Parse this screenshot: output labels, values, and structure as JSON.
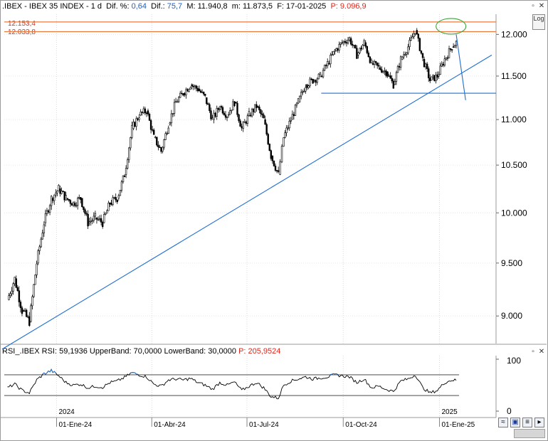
{
  "header": {
    "symbol": ".IBEX - IBEX 35 INDEX - 1 d",
    "dif_pct_label": "Dif. %:",
    "dif_pct_value": "0,64",
    "dif_label": "Dif.:",
    "dif_value": "75,7",
    "max_label": "M:",
    "max_value": "11.940,8",
    "min_label": "m:",
    "min_value": "11.873,5",
    "date_label": "F:",
    "date_value": "17-01-2025",
    "price_label": "P:",
    "price_value": "9.096,9"
  },
  "rsi_header": {
    "text": "RSI_.IBEX  RSI: 59,1936  UpperBand: 70,0000  LowerBand: 30,0000",
    "price_text": "P: 205,9524"
  },
  "buttons": {
    "log_label": "Log",
    "window_glyph_top": "▫",
    "close_glyph": "✕"
  },
  "level_labels": [
    "12.153,4",
    "12.033,8"
  ],
  "colors": {
    "candle": "#000000",
    "trendline": "#1f6fd1",
    "level_line": "#e87b3e",
    "highlight_ellipse": "#3aa53a",
    "rsi_line": "#000000",
    "rsi_overbought": "#1f6fd1",
    "price_red": "#e0261b"
  },
  "chart_data": [
    {
      "type": "line",
      "title": ".IBEX - IBEX 35 INDEX - 1 d",
      "y_axis": {
        "ticks": [
          "9.000",
          "9.500",
          "10.000",
          "10.500",
          "11.000",
          "11.500",
          "12.000"
        ],
        "ylim": [
          8750,
          12250
        ],
        "scale": "log"
      },
      "x_axis": {
        "ticks": [
          "01-Ene-24",
          "01-Abr-24",
          "01-Jul-24",
          "01-Oct-24",
          "01-Ene-25"
        ],
        "year_labels": [
          "2024",
          "2025"
        ]
      },
      "series": [
        {
          "style": "candlestick",
          "x": [
            "2023-11-15",
            "2023-11-22",
            "2023-11-29",
            "2023-12-06",
            "2023-12-13",
            "2023-12-20",
            "2023-12-27",
            "2024-01-03",
            "2024-01-10",
            "2024-01-17",
            "2024-01-24",
            "2024-01-31",
            "2024-02-07",
            "2024-02-14",
            "2024-02-21",
            "2024-02-28",
            "2024-03-06",
            "2024-03-13",
            "2024-03-20",
            "2024-03-27",
            "2024-04-03",
            "2024-04-10",
            "2024-04-17",
            "2024-04-24",
            "2024-05-01",
            "2024-05-08",
            "2024-05-15",
            "2024-05-22",
            "2024-05-29",
            "2024-06-05",
            "2024-06-12",
            "2024-06-19",
            "2024-06-26",
            "2024-07-03",
            "2024-07-10",
            "2024-07-17",
            "2024-07-24",
            "2024-07-31",
            "2024-08-05",
            "2024-08-12",
            "2024-08-19",
            "2024-08-26",
            "2024-09-02",
            "2024-09-09",
            "2024-09-16",
            "2024-09-23",
            "2024-09-30",
            "2024-10-07",
            "2024-10-14",
            "2024-10-21",
            "2024-10-28",
            "2024-11-04",
            "2024-11-11",
            "2024-11-18",
            "2024-11-25",
            "2024-12-02",
            "2024-12-09",
            "2024-12-16",
            "2024-12-23",
            "2024-12-30",
            "2025-01-06",
            "2025-01-13",
            "2025-01-17"
          ],
          "close": [
            9150,
            9350,
            9050,
            8950,
            9500,
            9900,
            10150,
            10250,
            10150,
            10100,
            10150,
            9900,
            9950,
            9900,
            10100,
            10150,
            10400,
            10900,
            11050,
            11100,
            10800,
            10650,
            10950,
            11200,
            11300,
            11400,
            11350,
            11250,
            11000,
            11150,
            11050,
            11200,
            10900,
            11050,
            11150,
            11000,
            10600,
            10400,
            10800,
            11000,
            11200,
            11400,
            11450,
            11500,
            11650,
            11800,
            11900,
            11950,
            11750,
            11900,
            11650,
            11600,
            11550,
            11400,
            11700,
            11850,
            12050,
            11700,
            11450,
            11500,
            11700,
            11850,
            11900
          ]
        },
        {
          "name": "12.153,4",
          "style": "horizontal-level",
          "value": 12153.4
        },
        {
          "name": "12.033,8",
          "style": "horizontal-level",
          "value": 12033.8
        },
        {
          "style": "support-level",
          "value": 11300
        },
        {
          "style": "trendline",
          "points": [
            [
              "2023-11-10",
              8700
            ],
            [
              "2025-02-20",
              11750
            ]
          ]
        }
      ]
    },
    {
      "type": "line",
      "title": "RSI_.IBEX",
      "y_axis": {
        "ticks": [
          "0",
          "100"
        ],
        "ylim": [
          0,
          100
        ]
      },
      "bands": {
        "upper": 70,
        "lower": 30
      },
      "series": [
        {
          "name": "RSI",
          "values": [
            45,
            52,
            40,
            35,
            60,
            72,
            78,
            68,
            55,
            50,
            52,
            45,
            48,
            46,
            55,
            58,
            65,
            74,
            70,
            66,
            52,
            48,
            60,
            62,
            60,
            63,
            55,
            50,
            42,
            55,
            50,
            56,
            40,
            48,
            55,
            45,
            28,
            25,
            50,
            58,
            62,
            66,
            62,
            64,
            66,
            70,
            68,
            66,
            55,
            62,
            45,
            48,
            42,
            38,
            58,
            62,
            70,
            45,
            35,
            40,
            55,
            60,
            59.19
          ]
        }
      ]
    }
  ]
}
